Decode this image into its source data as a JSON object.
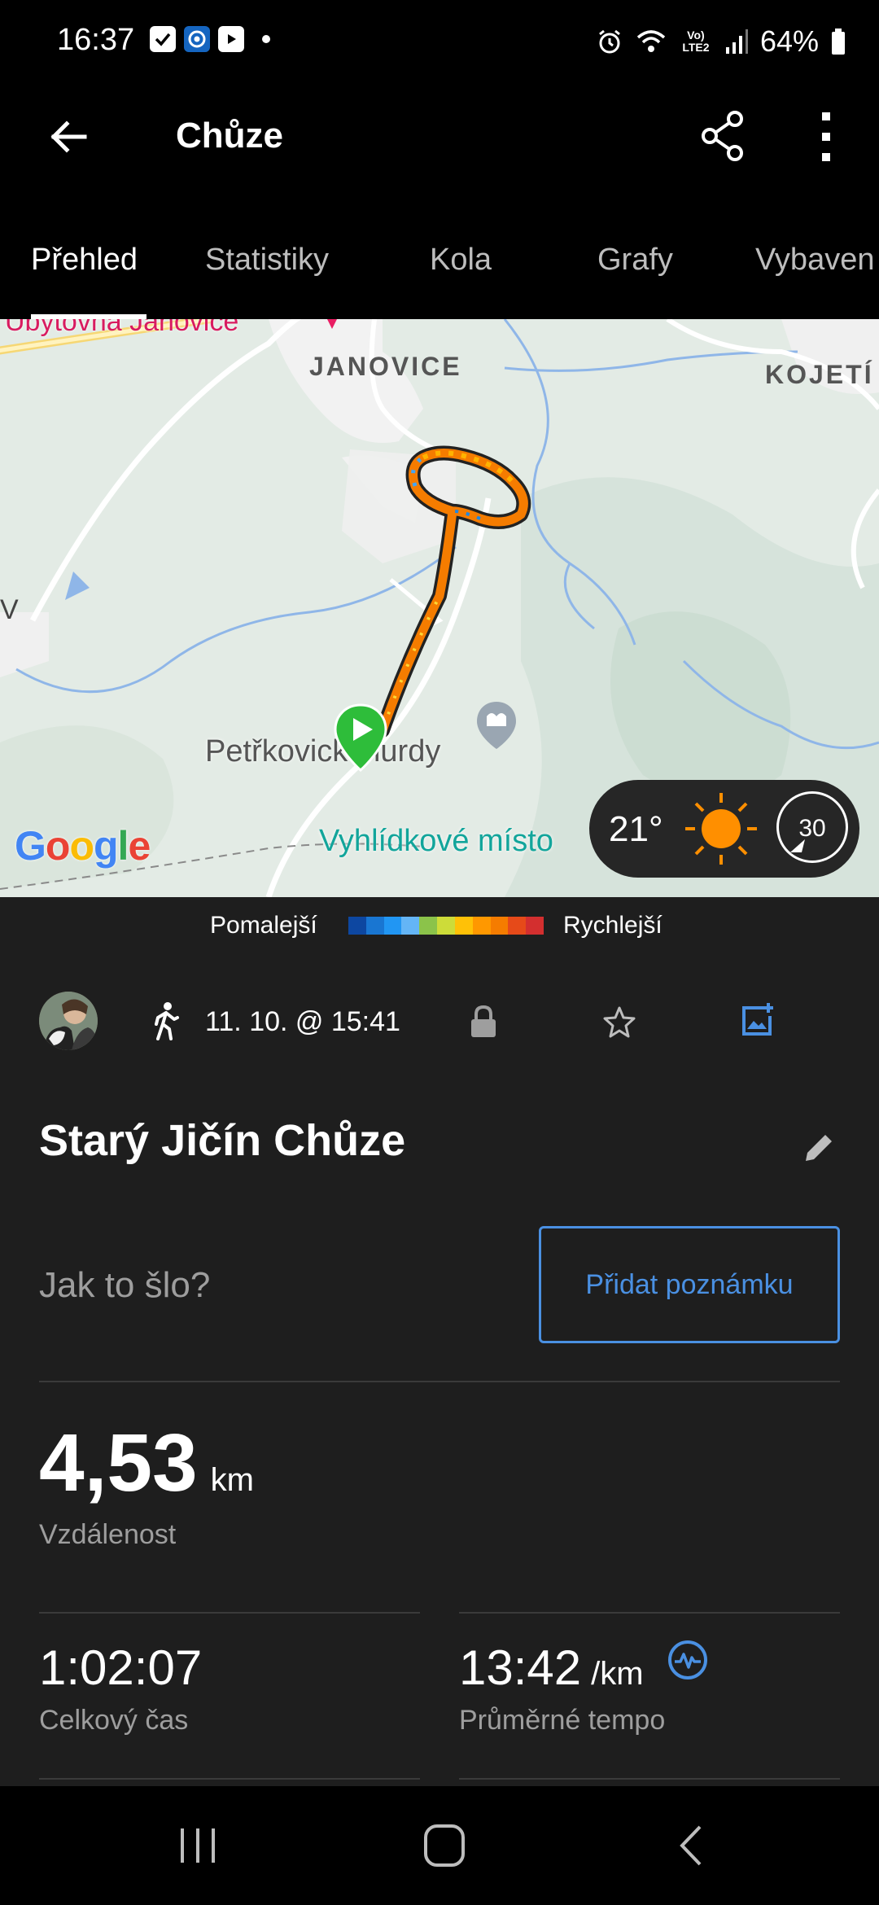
{
  "status_bar": {
    "time": "16:37",
    "battery": "64%",
    "network_label": "Vo) LTE2",
    "icons": [
      "check-notification-icon",
      "garmin-notification-icon",
      "youtube-notification-icon",
      "dot-icon",
      "alarm-icon",
      "wifi-icon",
      "signal-icon",
      "battery-icon"
    ]
  },
  "app_bar": {
    "title": "Chůze",
    "icons": [
      "back-arrow-icon",
      "share-icon",
      "more-vert-icon"
    ]
  },
  "tabs": [
    {
      "label": "Přehled",
      "active": true
    },
    {
      "label": "Statistiky",
      "active": false
    },
    {
      "label": "Kola",
      "active": false
    },
    {
      "label": "Grafy",
      "active": false
    },
    {
      "label": "Vybaven",
      "active": false
    }
  ],
  "map": {
    "labels": {
      "janovice": "JANOVICE",
      "kojeti": "KOJETÍ",
      "obytovna": "Ubytovna Janovice",
      "petrkovice": "Petřkovické lurdy",
      "vyhlidkove": "Vyhlídkové místo",
      "google": "Google",
      "edge_letter": "V"
    },
    "weather": {
      "temperature": "21°",
      "wind": "30",
      "condition_icon": "sun-icon"
    },
    "start_marker_icon": "play-marker-icon"
  },
  "legend": {
    "slower": "Pomalejší",
    "faster": "Rychlejší",
    "colors": [
      "#0d47a1",
      "#1976d2",
      "#2196f3",
      "#64b5f6",
      "#8bc34a",
      "#cddc39",
      "#ffc107",
      "#ff9800",
      "#f57c00",
      "#e64a19",
      "#d32f2f"
    ]
  },
  "activity_info": {
    "datetime": "11. 10. @ 15:41",
    "icons": [
      "avatar",
      "walking-icon",
      "lock-icon",
      "star-icon",
      "add-photo-icon"
    ]
  },
  "activity": {
    "name": "Starý Jičín Chůze",
    "note_prompt": "Jak to šlo?",
    "add_note_button": "Přidat poznámku"
  },
  "stats": {
    "distance": {
      "value": "4,53",
      "unit": "km",
      "label": "Vzdálenost"
    },
    "total_time": {
      "value": "1:02:07",
      "label": "Celkový čas"
    },
    "avg_pace": {
      "value": "13:42",
      "unit": "/km",
      "label": "Průměrné tempo"
    }
  },
  "nav_bar": {
    "icons": [
      "recent-apps-icon",
      "home-icon",
      "back-icon"
    ]
  },
  "colors": {
    "accent": "#4a90e2",
    "background": "#1e1e1e",
    "appbar": "#000000"
  }
}
